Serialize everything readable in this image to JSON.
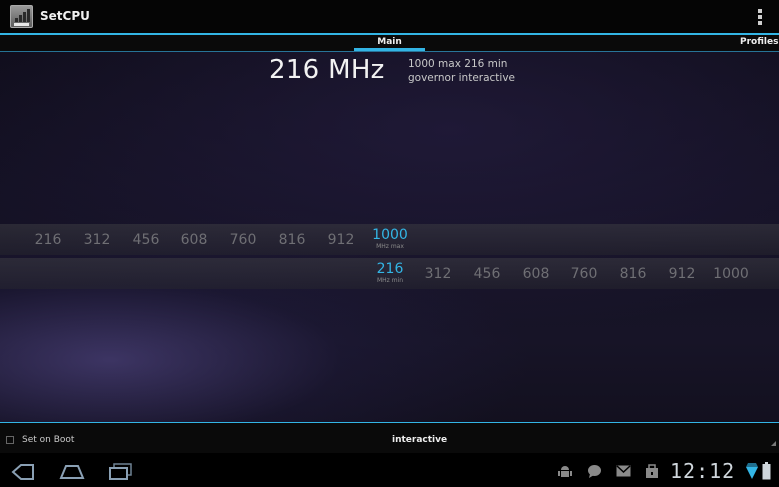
{
  "app": {
    "title": "SetCPU"
  },
  "tabs": [
    {
      "label": "Main"
    },
    {
      "label": "Profiles"
    }
  ],
  "current": {
    "freq": "216 MHz",
    "line1": "1000 max 216 min",
    "line2": "governor interactive"
  },
  "max_scale": {
    "values": [
      "216",
      "312",
      "456",
      "608",
      "760",
      "816",
      "912"
    ],
    "selected": "1000",
    "unit": "MHz max"
  },
  "min_scale": {
    "selected": "216",
    "unit": "MHz min",
    "values": [
      "312",
      "456",
      "608",
      "760",
      "816",
      "912",
      "1000"
    ]
  },
  "bottom": {
    "set_on_boot": "Set on Boot",
    "governor": "interactive"
  },
  "status": {
    "time": "12:12"
  },
  "colors": {
    "accent": "#33b5e5"
  },
  "icons": [
    "back-icon",
    "home-icon",
    "recent-apps-icon",
    "android-debug-icon",
    "chat-icon",
    "gmail-icon",
    "store-icon",
    "wifi-icon",
    "battery-icon",
    "overflow-menu-icon"
  ]
}
